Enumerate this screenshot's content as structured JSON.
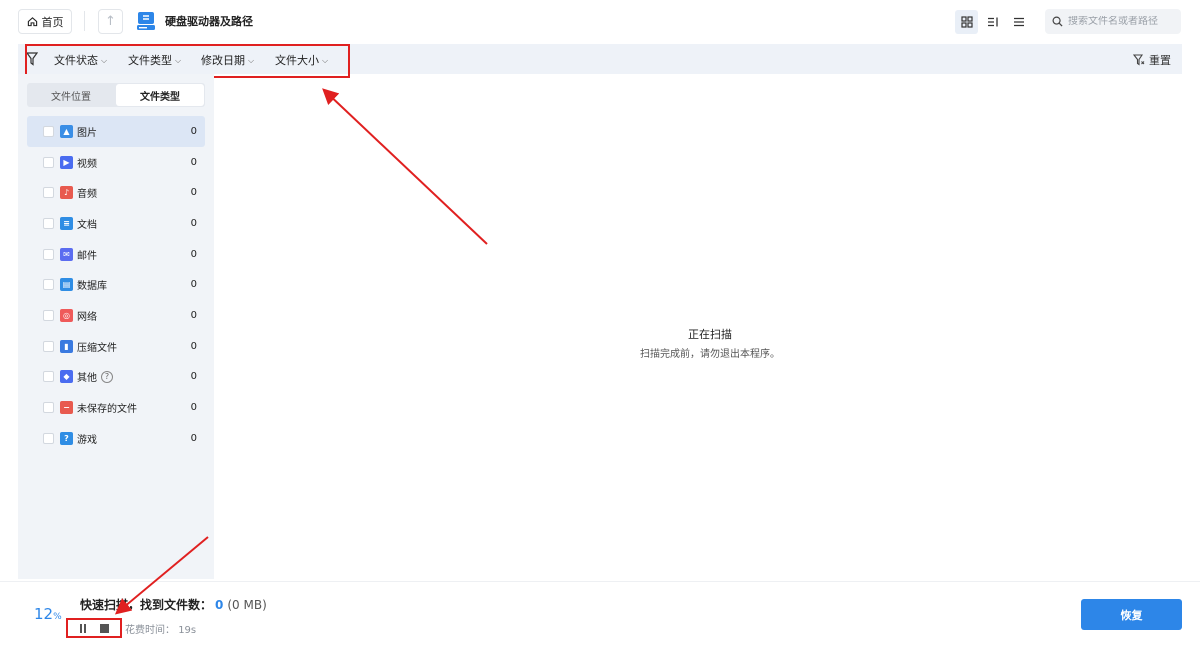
{
  "header": {
    "home_label": "首页",
    "title": "硬盘驱动器及路径",
    "search_placeholder": "搜索文件名或者路径"
  },
  "filters": {
    "items": [
      "文件状态",
      "文件类型",
      "修改日期",
      "文件大小"
    ],
    "reset_label": "重置"
  },
  "sidebar": {
    "tabs": [
      {
        "label": "文件位置",
        "active": false
      },
      {
        "label": "文件类型",
        "active": true
      }
    ],
    "categories": [
      {
        "label": "图片",
        "count": "0",
        "icon": "image-icon",
        "color": "#3a8ee6"
      },
      {
        "label": "视频",
        "count": "0",
        "icon": "video-icon",
        "color": "#4a6cf0"
      },
      {
        "label": "音频",
        "count": "0",
        "icon": "audio-icon",
        "color": "#e85a4f"
      },
      {
        "label": "文档",
        "count": "0",
        "icon": "document-icon",
        "color": "#2f8de4"
      },
      {
        "label": "邮件",
        "count": "0",
        "icon": "mail-icon",
        "color": "#5b6cf0"
      },
      {
        "label": "数据库",
        "count": "0",
        "icon": "database-icon",
        "color": "#2f8de4"
      },
      {
        "label": "网络",
        "count": "0",
        "icon": "network-icon",
        "color": "#ef5a5a"
      },
      {
        "label": "压缩文件",
        "count": "0",
        "icon": "archive-icon",
        "color": "#3a7ae0"
      },
      {
        "label": "其他",
        "count": "0",
        "icon": "other-icon",
        "color": "#4a6cf0"
      },
      {
        "label": "未保存的文件",
        "count": "0",
        "icon": "unsaved-file-icon",
        "color": "#e85a4f"
      },
      {
        "label": "游戏",
        "count": "0",
        "icon": "game-icon",
        "color": "#2f8de4"
      }
    ]
  },
  "main": {
    "status_title": "正在扫描",
    "status_sub": "扫描完成前，请勿退出本程序。"
  },
  "footer": {
    "progress_value": "12",
    "progress_unit": "%",
    "scan_label": "快速扫描，找到文件数：",
    "found_count": "0",
    "found_size": "(0 MB)",
    "time_label": "花费时间：",
    "time_value": "19s",
    "restore_label": "恢复"
  },
  "colors": {
    "accent": "#2d86e8",
    "annotation": "#e02020"
  }
}
